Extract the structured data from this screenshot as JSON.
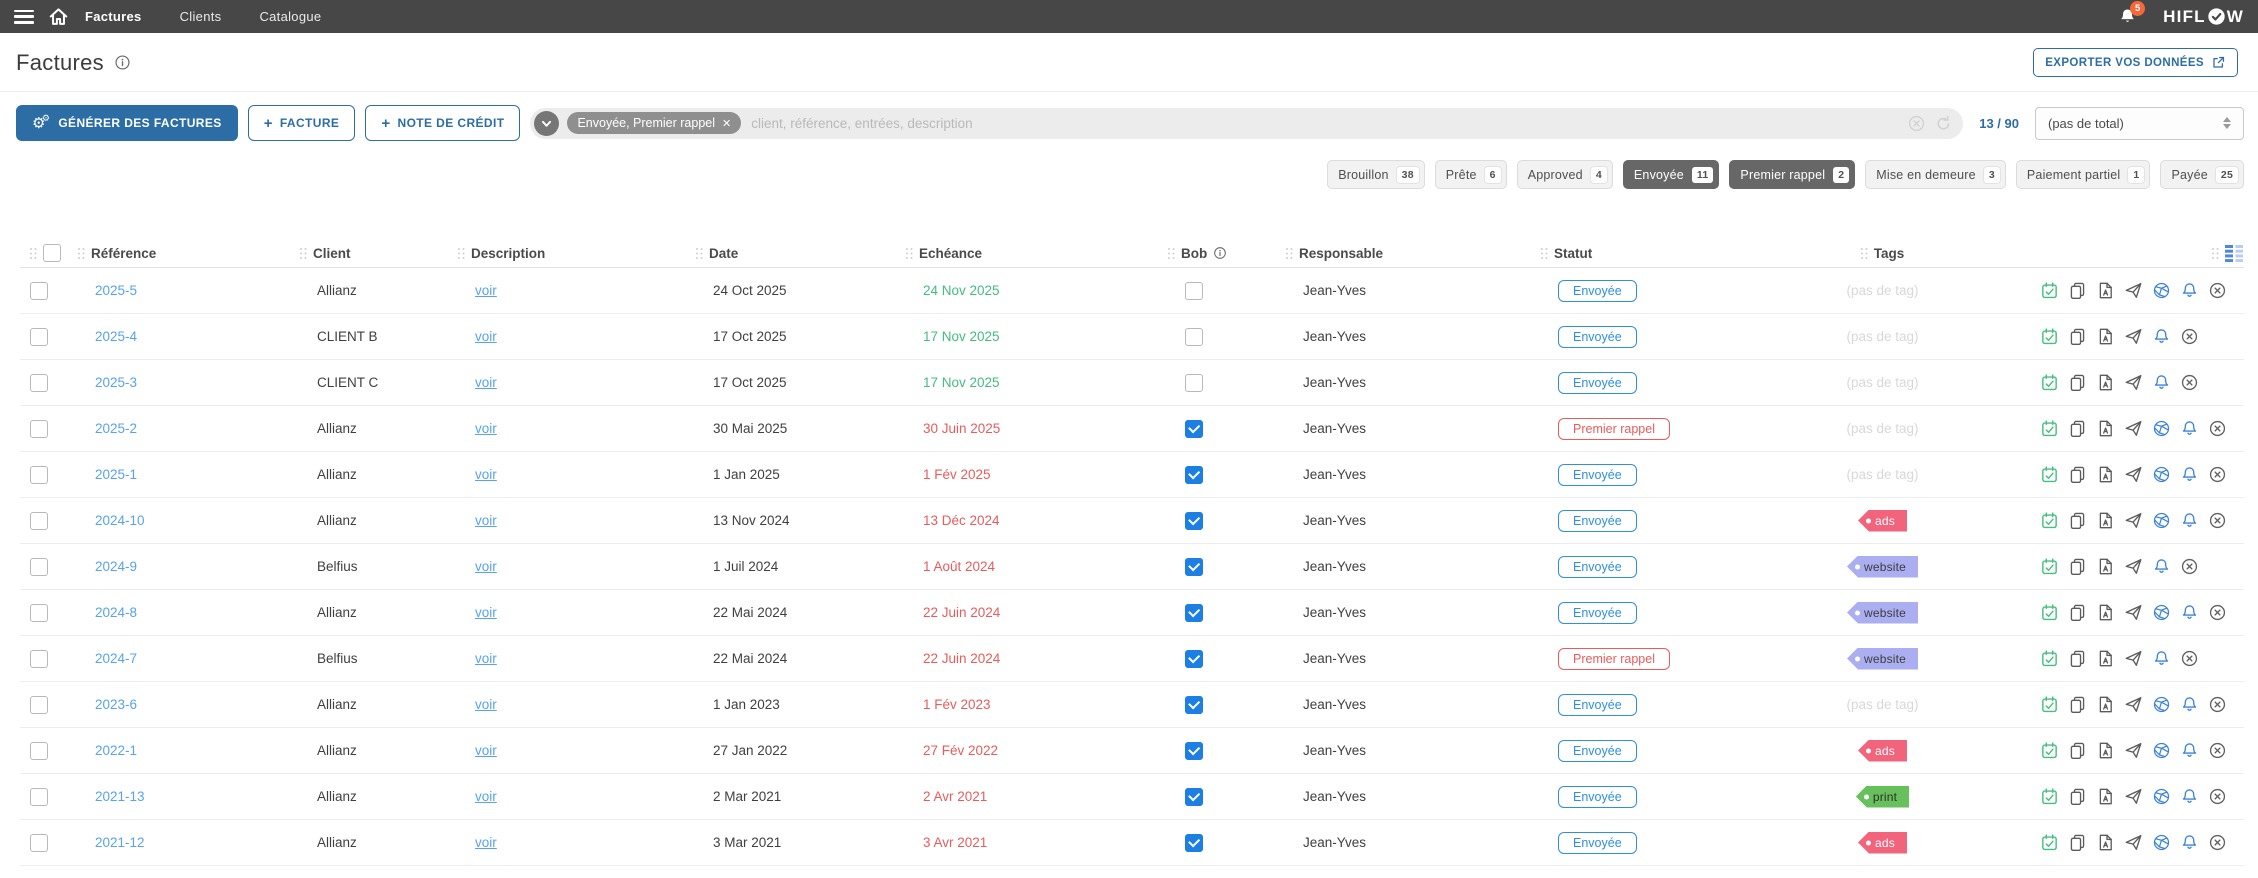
{
  "navbar": {
    "items": [
      {
        "label": "Factures",
        "active": true
      },
      {
        "label": "Clients",
        "active": false
      },
      {
        "label": "Catalogue",
        "active": false
      }
    ],
    "notification_count": "5",
    "brand_left": "HIFL",
    "brand_right": "W"
  },
  "page": {
    "title": "Factures",
    "export_button": "EXPORTER VOS DONNÉES"
  },
  "toolbar": {
    "generate_button": "GÉNÉRER DES FACTURES",
    "new_invoice_button": "FACTURE",
    "new_credit_note_button": "NOTE DE CRÉDIT",
    "filter_chip": "Envoyée, Premier rappel",
    "search_placeholder": "client, référence, entrées, description",
    "count": "13 / 90",
    "total_select": "(pas de total)"
  },
  "status_filters": [
    {
      "label": "Brouillon",
      "count": "38",
      "selected": false
    },
    {
      "label": "Prête",
      "count": "6",
      "selected": false
    },
    {
      "label": "Approved",
      "count": "4",
      "selected": false
    },
    {
      "label": "Envoyée",
      "count": "11",
      "selected": true
    },
    {
      "label": "Premier rappel",
      "count": "2",
      "selected": true
    },
    {
      "label": "Mise en demeure",
      "count": "3",
      "selected": false
    },
    {
      "label": "Paiement partiel",
      "count": "1",
      "selected": false
    },
    {
      "label": "Payée",
      "count": "25",
      "selected": false
    }
  ],
  "table": {
    "headers": {
      "reference": "Référence",
      "client": "Client",
      "description": "Description",
      "date": "Date",
      "due": "Echéance",
      "bob": "Bob",
      "responsable": "Responsable",
      "status": "Statut",
      "tags": "Tags"
    },
    "description_link_label": "voir",
    "no_tag_label": "(pas de tag)",
    "action_icons": [
      "calendar-check",
      "copy",
      "pdf-file",
      "paper-plane",
      "globe-network",
      "bell",
      "close-circle"
    ],
    "rows": [
      {
        "reference": "2025-5",
        "client": "Allianz",
        "date": "24 Oct 2025",
        "due": "24 Nov 2025",
        "due_state": "future",
        "bob": false,
        "responsable": "Jean-Yves",
        "statut": "Envoyée",
        "statut_state": "sent",
        "tag": null,
        "has_globe": true
      },
      {
        "reference": "2025-4",
        "client": "CLIENT B",
        "date": "17 Oct 2025",
        "due": "17 Nov 2025",
        "due_state": "future",
        "bob": false,
        "responsable": "Jean-Yves",
        "statut": "Envoyée",
        "statut_state": "sent",
        "tag": null,
        "has_globe": false
      },
      {
        "reference": "2025-3",
        "client": "CLIENT C",
        "date": "17 Oct 2025",
        "due": "17 Nov 2025",
        "due_state": "future",
        "bob": false,
        "responsable": "Jean-Yves",
        "statut": "Envoyée",
        "statut_state": "sent",
        "tag": null,
        "has_globe": false
      },
      {
        "reference": "2025-2",
        "client": "Allianz",
        "date": "30 Mai 2025",
        "due": "30 Juin 2025",
        "due_state": "overdue",
        "bob": true,
        "responsable": "Jean-Yves",
        "statut": "Premier rappel",
        "statut_state": "reminder",
        "tag": null,
        "has_globe": true
      },
      {
        "reference": "2025-1",
        "client": "Allianz",
        "date": "1 Jan 2025",
        "due": "1 Fév 2025",
        "due_state": "overdue",
        "bob": true,
        "responsable": "Jean-Yves",
        "statut": "Envoyée",
        "statut_state": "sent",
        "tag": null,
        "has_globe": true
      },
      {
        "reference": "2024-10",
        "client": "Allianz",
        "date": "13 Nov 2024",
        "due": "13 Déc 2024",
        "due_state": "overdue",
        "bob": true,
        "responsable": "Jean-Yves",
        "statut": "Envoyée",
        "statut_state": "sent",
        "tag": "ads",
        "has_globe": true
      },
      {
        "reference": "2024-9",
        "client": "Belfius",
        "date": "1 Juil 2024",
        "due": "1 Août 2024",
        "due_state": "overdue",
        "bob": true,
        "responsable": "Jean-Yves",
        "statut": "Envoyée",
        "statut_state": "sent",
        "tag": "website",
        "has_globe": false
      },
      {
        "reference": "2024-8",
        "client": "Allianz",
        "date": "22 Mai 2024",
        "due": "22 Juin 2024",
        "due_state": "overdue",
        "bob": true,
        "responsable": "Jean-Yves",
        "statut": "Envoyée",
        "statut_state": "sent",
        "tag": "website",
        "has_globe": true
      },
      {
        "reference": "2024-7",
        "client": "Belfius",
        "date": "22 Mai 2024",
        "due": "22 Juin 2024",
        "due_state": "overdue",
        "bob": true,
        "responsable": "Jean-Yves",
        "statut": "Premier rappel",
        "statut_state": "reminder",
        "tag": "website",
        "has_globe": false
      },
      {
        "reference": "2023-6",
        "client": "Allianz",
        "date": "1 Jan 2023",
        "due": "1 Fév 2023",
        "due_state": "overdue",
        "bob": true,
        "responsable": "Jean-Yves",
        "statut": "Envoyée",
        "statut_state": "sent",
        "tag": null,
        "has_globe": true
      },
      {
        "reference": "2022-1",
        "client": "Allianz",
        "date": "27 Jan 2022",
        "due": "27 Fév 2022",
        "due_state": "overdue",
        "bob": true,
        "responsable": "Jean-Yves",
        "statut": "Envoyée",
        "statut_state": "sent",
        "tag": "ads",
        "has_globe": true
      },
      {
        "reference": "2021-13",
        "client": "Allianz",
        "date": "2 Mar 2021",
        "due": "2 Avr 2021",
        "due_state": "overdue",
        "bob": true,
        "responsable": "Jean-Yves",
        "statut": "Envoyée",
        "statut_state": "sent",
        "tag": "print",
        "has_globe": true
      },
      {
        "reference": "2021-12",
        "client": "Allianz",
        "date": "3 Mar 2021",
        "due": "3 Avr 2021",
        "due_state": "overdue",
        "bob": true,
        "responsable": "Jean-Yves",
        "statut": "Envoyée",
        "statut_state": "sent",
        "tag": "ads",
        "has_globe": true
      }
    ]
  },
  "tag_colors": {
    "ads": {
      "bg": "#f2637c",
      "text": "#ffffff"
    },
    "website": {
      "bg": "#abaff2",
      "text": "#3c3c3c"
    },
    "print": {
      "bg": "#68c05c",
      "text": "#2f2f2f"
    }
  },
  "colors": {
    "primary_blue": "#2d6da5",
    "status_sent_blue": "#2e8fe0",
    "status_reminder_red": "#e85c5c",
    "due_future_green": "#42bd80",
    "due_overdue_red": "#e85c5c",
    "navbar_bg": "#474747",
    "notification_orange": "#f4683a"
  }
}
